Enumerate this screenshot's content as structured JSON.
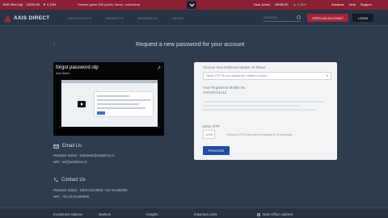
{
  "ticker": {
    "left_name": "BSE Mid-Cap",
    "left_value": "14226.53",
    "left_change": "▼ 0.13%",
    "news": "Sensex gains 250 points; banks, metal lead",
    "right_name": "Dow Jones",
    "right_value": "26058.30",
    "right_change": "▲ 0.36%",
    "links": [
      "Advance",
      "Help",
      "Support"
    ]
  },
  "header": {
    "brand": "AXIS DIRECT",
    "nav": [
      "DERIVATIVES",
      "MARKETS",
      "RESEARCH",
      "LEARN"
    ],
    "search_placeholder": "SEARCH",
    "open_account": "OPEN AN ACCOUNT",
    "login": "LOGIN"
  },
  "main": {
    "heading": "Request a new password for your account",
    "back": "‹"
  },
  "video": {
    "title": "forgot password otp",
    "channel": "Axis Direct",
    "share": "↗"
  },
  "form": {
    "choose_label": "Choose Your Preferred Option To Reset",
    "select_value": "Send OTP to my registered mobile number",
    "mobile_label": "Your Registered Mobile No",
    "mobile_value": "XXXXXX1112",
    "otp_label": "Enter OTP",
    "otp_value": "1234",
    "otp_note": "Resend OTP (Link will be enabled in 30 seconds)",
    "proceed": "PROCEED"
  },
  "contact": {
    "email_heading": "Email Us",
    "email_resident": "Resident Indian : helpdesk@axisdirect.in",
    "email_nri": "NRI : nri@axisdirect.in",
    "phone_heading": "Contact Us",
    "phone_resident": "Resident Indian : 1800-210-0808 / 022-61480808",
    "phone_nri": "NRI : +91-22-61480808"
  },
  "footer": {
    "items": [
      "Investment Options",
      "Markets",
      "Insights",
      "Important Links",
      "Main Office Address"
    ]
  }
}
